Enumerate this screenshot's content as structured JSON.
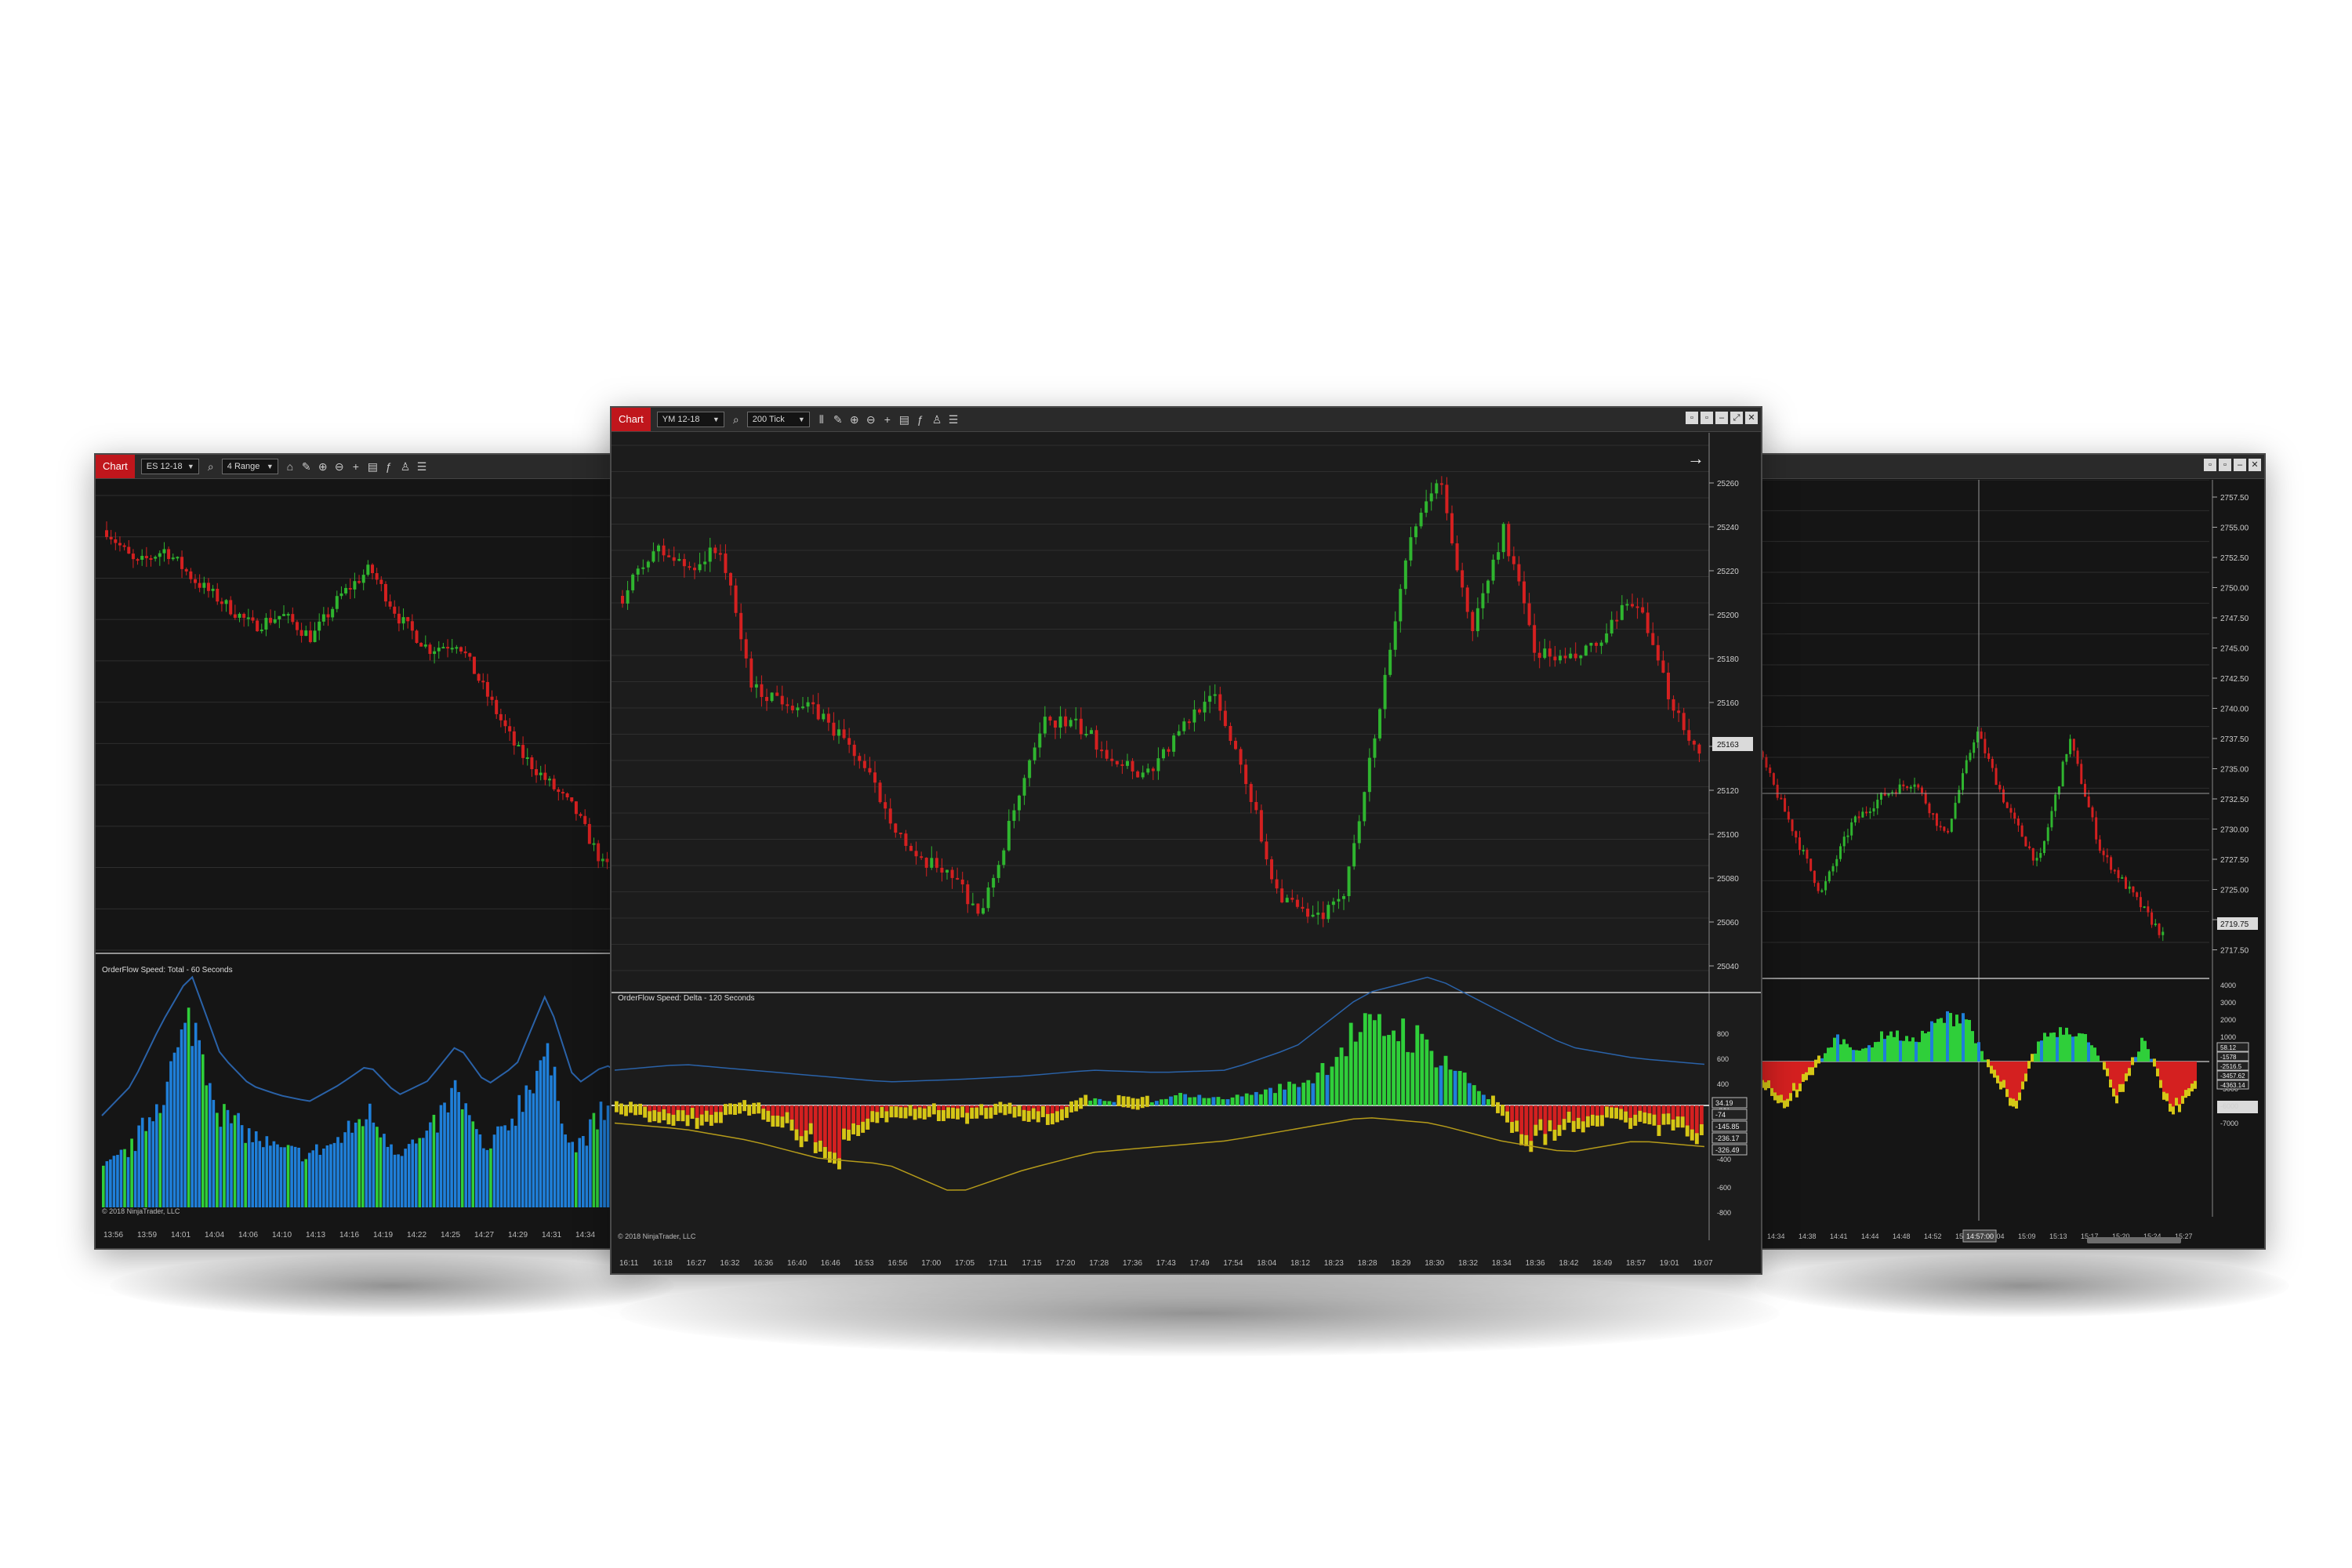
{
  "colors": {
    "up": "#2fb52f",
    "down": "#d42020",
    "blue": "#1f7fd9",
    "green": "#2fcf3a",
    "yellow": "#d4c716",
    "red": "#d42020",
    "grid": "#2e2e2e",
    "axis_text": "#cfcfcf"
  },
  "left_window": {
    "tab_label": "Chart",
    "instrument": "ES 12-18",
    "bar_type": "4 Range",
    "indicator_label": "OrderFlow Speed: Total - 60 Seconds",
    "copyright": "© 2018 NinjaTrader, LLC",
    "time_labels": [
      "13:56",
      "13:59",
      "14:01",
      "14:04",
      "14:06",
      "14:10",
      "14:13",
      "14:16",
      "14:19",
      "14:22",
      "14:25",
      "14:27",
      "14:29",
      "14:31",
      "14:34"
    ]
  },
  "center_window": {
    "tab_label": "Chart",
    "instrument": "YM 12-18",
    "bar_type": "200 Tick",
    "window_buttons": [
      "▫",
      "▫",
      "–",
      "⤢",
      "✕"
    ],
    "price_labels": [
      "25260",
      "25240",
      "25220",
      "25200",
      "25180",
      "25160",
      "25140",
      "25120",
      "25100",
      "25080",
      "25060",
      "25040"
    ],
    "current_price": "25163",
    "indicator_label": "OrderFlow Speed: Delta - 120 Seconds",
    "indicator_ticks": [
      "800",
      "600",
      "400",
      "200",
      "-400",
      "-600",
      "-800"
    ],
    "indicator_markers": [
      "34.19",
      "-74",
      "-145.85",
      "-236.17",
      "-326.49"
    ],
    "copyright": "© 2018 NinjaTrader, LLC",
    "time_labels": [
      "16:11",
      "16:18",
      "16:27",
      "16:32",
      "16:36",
      "16:40",
      "16:46",
      "16:53",
      "16:56",
      "17:00",
      "17:05",
      "17:11",
      "17:15",
      "17:20",
      "17:28",
      "17:36",
      "17:43",
      "17:49",
      "17:54",
      "18:04",
      "18:12",
      "18:23",
      "18:28",
      "18:29",
      "18:30",
      "18:32",
      "18:34",
      "18:36",
      "18:42",
      "18:49",
      "18:57",
      "19:01",
      "19:07"
    ]
  },
  "right_window": {
    "window_buttons": [
      "▫",
      "▫",
      "–",
      "✕"
    ],
    "price_labels": [
      "2757.50",
      "2755.00",
      "2752.50",
      "2750.00",
      "2747.50",
      "2745.00",
      "2742.50",
      "2740.00",
      "2737.50",
      "2735.00",
      "2732.50",
      "2730.00",
      "2727.50",
      "2725.00",
      "2722.50",
      "2717.50"
    ],
    "crosshair_price": "2744.25",
    "current_price": "2719.75",
    "indicator_ticks": [
      "4000",
      "3000",
      "2000",
      "1000",
      "-1000",
      "-3000",
      "-5000",
      "-6000",
      "-7000"
    ],
    "indicator_markers": [
      "58.12",
      "-1578",
      "-2516.5",
      "-3457.62",
      "-4363.14"
    ],
    "crosshair_time": "14:57:00",
    "time_labels": [
      "14:34",
      "14:38",
      "14:41",
      "14:44",
      "14:48",
      "14:52",
      "15:01",
      "15:04",
      "15:09",
      "15:13",
      "15:17",
      "15:20",
      "15:24",
      "15:27"
    ]
  }
}
